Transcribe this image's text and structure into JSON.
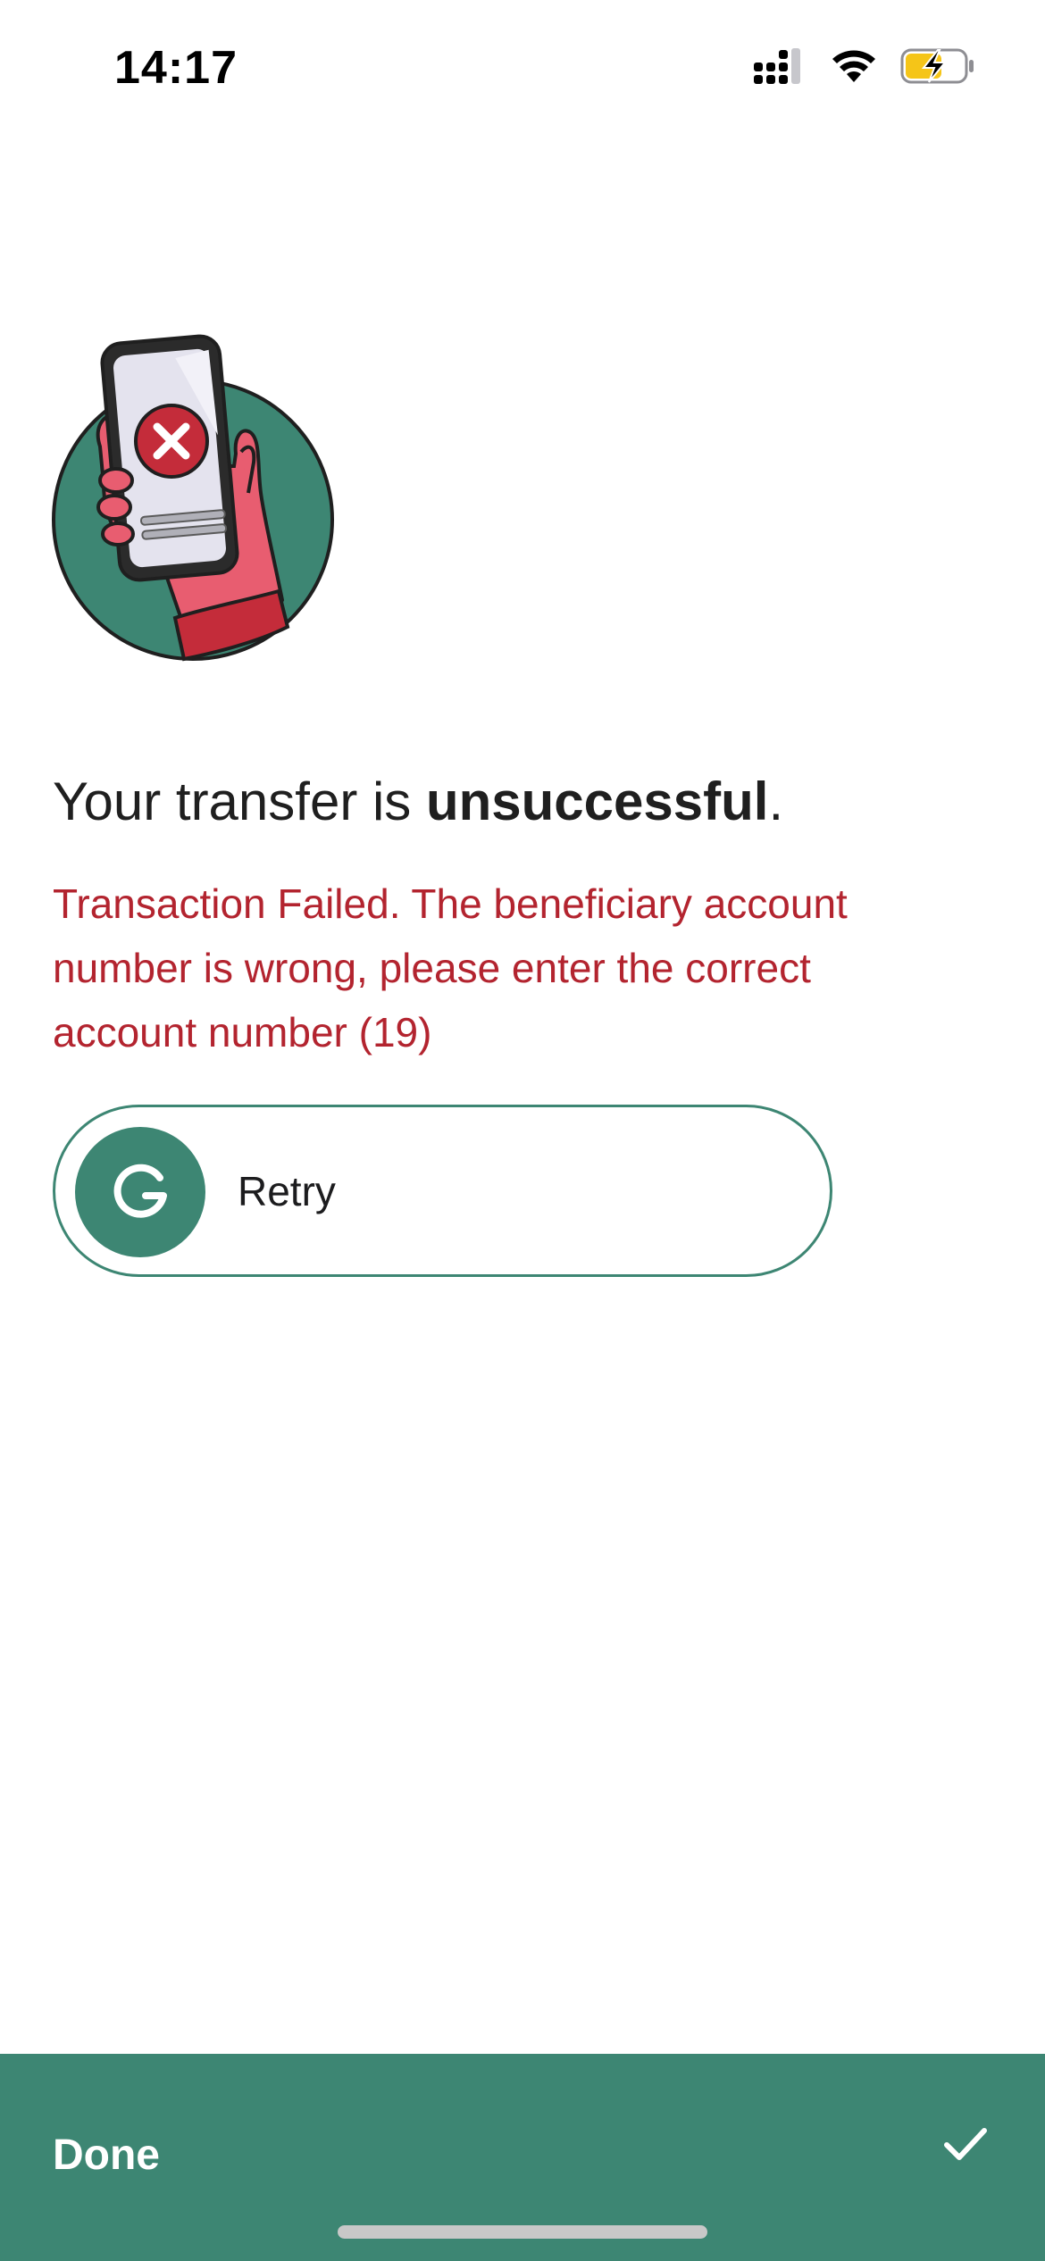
{
  "status_bar": {
    "time": "14:17",
    "icons": [
      "cellular-signal-icon",
      "wifi-icon",
      "battery-charging-icon"
    ]
  },
  "result": {
    "headline_prefix": "Your transfer is ",
    "headline_emphasis": "unsuccessful",
    "headline_suffix": ".",
    "error_message": "Transaction Failed. The beneficiary account number is wrong, please enter the correct account number (19)",
    "illustration": "phone-failure-illustration"
  },
  "retry": {
    "label": "Retry",
    "icon": "retry-icon"
  },
  "footer": {
    "done_label": "Done",
    "icon": "checkmark-icon"
  },
  "colors": {
    "accent": "#3d8673",
    "error": "#b3242f",
    "text": "#1f1f1f",
    "background": "#ffffff"
  }
}
